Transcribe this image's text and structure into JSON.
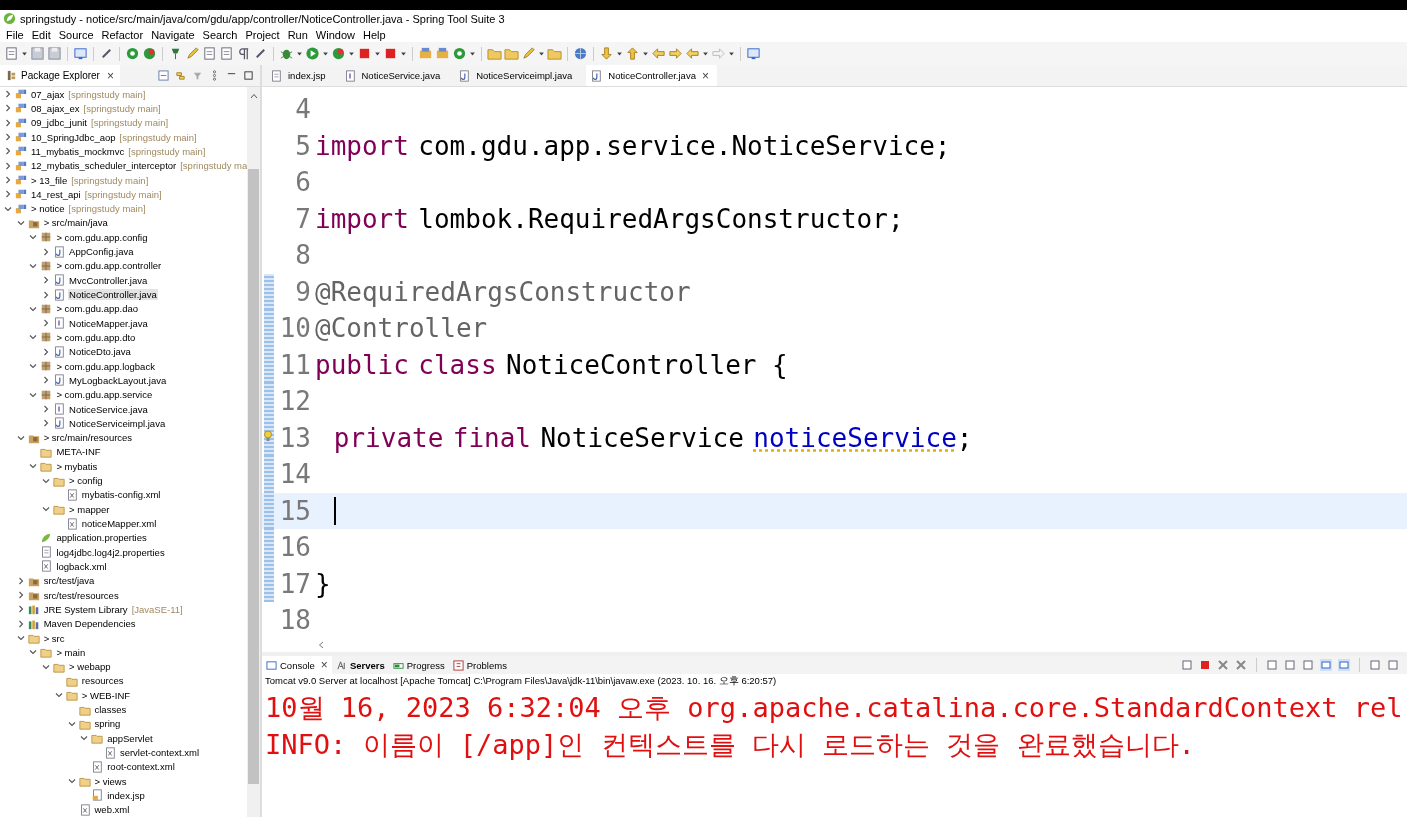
{
  "window": {
    "title": "springstudy - notice/src/main/java/com/gdu/app/controller/NoticeController.java - Spring Tool Suite 3"
  },
  "menu": [
    "File",
    "Edit",
    "Source",
    "Refactor",
    "Navigate",
    "Search",
    "Project",
    "Run",
    "Window",
    "Help"
  ],
  "explorer": {
    "title": "Package Explorer",
    "close": "×",
    "tree": [
      {
        "label": "07_ajax",
        "suffix": "[springstudy main]",
        "kind": "project",
        "expanded": false,
        "selected": false
      },
      {
        "label": "08_ajax_ex",
        "suffix": "[springstudy main]",
        "kind": "project",
        "expanded": false,
        "selected": false
      },
      {
        "label": "09_jdbc_junit",
        "suffix": "[springstudy main]",
        "kind": "project",
        "expanded": false,
        "selected": false
      },
      {
        "label": "10_SpringJdbc_aop",
        "suffix": "[springstudy main]",
        "kind": "project",
        "expanded": false,
        "selected": false
      },
      {
        "label": "11_mybatis_mockmvc",
        "suffix": "[springstudy main]",
        "kind": "project",
        "expanded": false,
        "selected": false
      },
      {
        "label": "12_mybatis_scheduler_interceptor",
        "suffix": "[springstudy ma",
        "kind": "project",
        "expanded": false,
        "selected": false
      },
      {
        "label": "> 13_file",
        "suffix": "[springstudy main]",
        "kind": "project",
        "expanded": false,
        "selected": false
      },
      {
        "label": "14_rest_api",
        "suffix": "[springstudy main]",
        "kind": "project",
        "expanded": false,
        "selected": false
      },
      {
        "label": "> notice",
        "suffix": "[springstudy main]",
        "kind": "project",
        "expanded": true,
        "selected": false,
        "children": [
          {
            "label": "> src/main/java",
            "kind": "srcfolder",
            "expanded": true,
            "selected": false,
            "children": [
              {
                "label": "> com.gdu.app.config",
                "kind": "package",
                "expanded": true,
                "selected": false,
                "children": [
                  {
                    "label": "AppConfig.java",
                    "kind": "java",
                    "expanded": false,
                    "selected": false
                  }
                ]
              },
              {
                "label": "> com.gdu.app.controller",
                "kind": "package",
                "expanded": true,
                "selected": false,
                "children": [
                  {
                    "label": "MvcController.java",
                    "kind": "java",
                    "expanded": false,
                    "selected": false
                  },
                  {
                    "label": "NoticeController.java",
                    "kind": "java",
                    "expanded": false,
                    "selected": true
                  }
                ]
              },
              {
                "label": "> com.gdu.app.dao",
                "kind": "package",
                "expanded": true,
                "selected": false,
                "children": [
                  {
                    "label": "NoticeMapper.java",
                    "kind": "interface",
                    "expanded": false,
                    "selected": false
                  }
                ]
              },
              {
                "label": "> com.gdu.app.dto",
                "kind": "package",
                "expanded": true,
                "selected": false,
                "children": [
                  {
                    "label": "NoticeDto.java",
                    "kind": "java",
                    "expanded": false,
                    "selected": false
                  }
                ]
              },
              {
                "label": "> com.gdu.app.logback",
                "kind": "package",
                "expanded": true,
                "selected": false,
                "children": [
                  {
                    "label": "MyLogbackLayout.java",
                    "kind": "java",
                    "expanded": false,
                    "selected": false
                  }
                ]
              },
              {
                "label": "> com.gdu.app.service",
                "kind": "package",
                "expanded": true,
                "selected": false,
                "children": [
                  {
                    "label": "NoticeService.java",
                    "kind": "interface",
                    "expanded": false,
                    "selected": false
                  },
                  {
                    "label": "NoticeServiceimpl.java",
                    "kind": "java",
                    "expanded": false,
                    "selected": false
                  }
                ]
              }
            ]
          },
          {
            "label": "> src/main/resources",
            "kind": "srcfolder",
            "expanded": true,
            "selected": false,
            "children": [
              {
                "label": "META-INF",
                "kind": "folder",
                "selected": false
              },
              {
                "label": "> mybatis",
                "kind": "folder",
                "expanded": true,
                "selected": false,
                "children": [
                  {
                    "label": "> config",
                    "kind": "folder",
                    "expanded": true,
                    "selected": false,
                    "children": [
                      {
                        "label": "mybatis-config.xml",
                        "kind": "xml",
                        "selected": false
                      }
                    ]
                  },
                  {
                    "label": "> mapper",
                    "kind": "folder",
                    "expanded": true,
                    "selected": false,
                    "children": [
                      {
                        "label": "noticeMapper.xml",
                        "kind": "xml",
                        "selected": false
                      }
                    ]
                  }
                ]
              },
              {
                "label": "application.properties",
                "kind": "props",
                "selected": false
              },
              {
                "label": "log4jdbc.log4j2.properties",
                "kind": "file",
                "selected": false
              },
              {
                "label": "logback.xml",
                "kind": "xml",
                "selected": false
              }
            ]
          },
          {
            "label": "src/test/java",
            "kind": "srcfolder",
            "expanded": false,
            "selected": false
          },
          {
            "label": "src/test/resources",
            "kind": "srcfolder",
            "expanded": false,
            "selected": false
          },
          {
            "label": "JRE System Library",
            "suffix": "[JavaSE-11]",
            "kind": "library",
            "expanded": false,
            "selected": false
          },
          {
            "label": "Maven Dependencies",
            "kind": "library",
            "expanded": false,
            "selected": false
          },
          {
            "label": "> src",
            "kind": "folder",
            "expanded": true,
            "selected": false,
            "children": [
              {
                "label": "> main",
                "kind": "folder",
                "expanded": true,
                "selected": false,
                "children": [
                  {
                    "label": "> webapp",
                    "kind": "folder",
                    "expanded": true,
                    "selected": false,
                    "children": [
                      {
                        "label": "resources",
                        "kind": "folder",
                        "selected": false
                      },
                      {
                        "label": "> WEB-INF",
                        "kind": "folder",
                        "expanded": true,
                        "selected": false,
                        "children": [
                          {
                            "label": "classes",
                            "kind": "folder",
                            "selected": false
                          },
                          {
                            "label": "spring",
                            "kind": "folder",
                            "expanded": true,
                            "selected": false,
                            "children": [
                              {
                                "label": "appServlet",
                                "kind": "folder",
                                "expanded": true,
                                "selected": false,
                                "children": [
                                  {
                                    "label": "servlet-context.xml",
                                    "kind": "xml",
                                    "selected": false
                                  }
                                ]
                              },
                              {
                                "label": "root-context.xml",
                                "kind": "xml",
                                "selected": false
                              }
                            ]
                          },
                          {
                            "label": "> views",
                            "kind": "folder",
                            "expanded": true,
                            "selected": false,
                            "children": [
                              {
                                "label": "index.jsp",
                                "kind": "jsp",
                                "selected": false
                              }
                            ]
                          },
                          {
                            "label": "web.xml",
                            "kind": "xml",
                            "selected": false
                          }
                        ]
                      }
                    ]
                  }
                ]
              }
            ]
          }
        ]
      }
    ]
  },
  "editor_tabs": [
    {
      "label": "index.jsp",
      "kind": "jsp",
      "selected": false
    },
    {
      "label": "NoticeService.java",
      "kind": "interface",
      "selected": false
    },
    {
      "label": "NoticeServiceimpl.java",
      "kind": "java",
      "selected": false
    },
    {
      "label": "NoticeController.java",
      "kind": "java",
      "selected": true,
      "close": "×"
    }
  ],
  "code": [
    {
      "number": "4"
    },
    {
      "number": "5",
      "tokens": [
        {
          "text": "import",
          "kind": "keyword"
        },
        {
          "text": "com.gdu.app.service.NoticeService;",
          "kind": "plain"
        }
      ]
    },
    {
      "number": "6"
    },
    {
      "number": "7",
      "tokens": [
        {
          "text": "import",
          "kind": "keyword"
        },
        {
          "text": "lombok.RequiredArgsConstructor;",
          "kind": "plain"
        }
      ]
    },
    {
      "number": "8"
    },
    {
      "number": "9",
      "changed": true,
      "tokens": [
        {
          "text": "@RequiredArgsConstructor",
          "kind": "annotation"
        }
      ]
    },
    {
      "number": "10",
      "changed": true,
      "tokens": [
        {
          "text": "@Controller",
          "kind": "annotation"
        }
      ]
    },
    {
      "number": "11",
      "changed": true,
      "tokens": [
        {
          "text": "public",
          "kind": "keyword"
        },
        {
          "text": "class",
          "kind": "keyword"
        },
        {
          "text": "NoticeController {",
          "kind": "plain"
        }
      ]
    },
    {
      "number": "12",
      "changed": true
    },
    {
      "number": "13",
      "changed": true,
      "warning": true,
      "indented": true,
      "tokens": [
        {
          "text": "private",
          "kind": "keyword"
        },
        {
          "text": "final",
          "kind": "keyword"
        },
        {
          "text": "NoticeService",
          "kind": "plain"
        },
        {
          "text": "noticeService",
          "kind": "field"
        },
        {
          "text": ";",
          "kind": "plain",
          "attached": true
        }
      ]
    },
    {
      "number": "14",
      "changed": true
    },
    {
      "number": "15",
      "changed": true,
      "current": true,
      "indented": true
    },
    {
      "number": "16",
      "changed": true
    },
    {
      "number": "17",
      "changed": true,
      "tokens": [
        {
          "text": "}",
          "kind": "plain"
        }
      ]
    },
    {
      "number": "18"
    }
  ],
  "console": {
    "tabs": [
      {
        "label": "Console",
        "selected": true,
        "updated": false,
        "close": "×"
      },
      {
        "label": "Servers",
        "selected": false,
        "updated": true
      },
      {
        "label": "Progress",
        "selected": false,
        "updated": false
      },
      {
        "label": "Problems",
        "selected": false,
        "updated": false
      }
    ],
    "description": "Tomcat v9.0 Server at localhost [Apache Tomcat] C:\\Program Files\\Java\\jdk-11\\bin\\javaw.exe  (2023. 10. 16. 오후 6:20:57)",
    "output": [
      "10월 16, 2023 6:32:04 오후 org.apache.catalina.core.StandardContext rel",
      "INFO: 이름이 [/app]인 컨텍스트를 다시 로드하는 것을 완료했습니다."
    ]
  }
}
